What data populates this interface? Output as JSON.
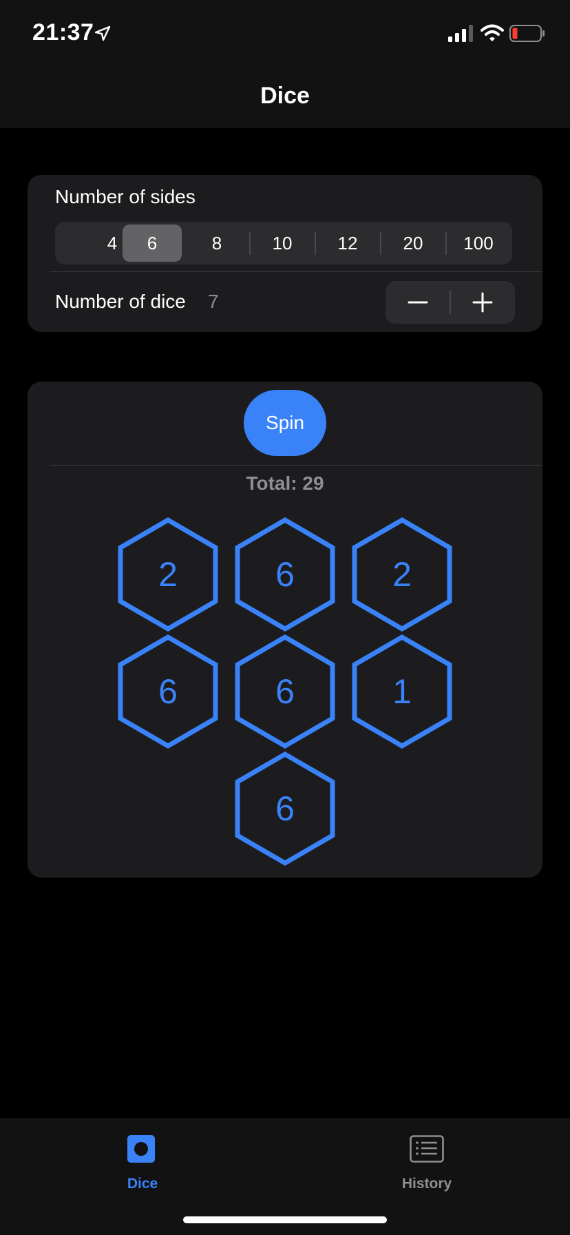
{
  "status_bar": {
    "time": "21:37",
    "icons": [
      "location-arrow-icon",
      "cellular-signal-icon",
      "wifi-icon",
      "battery-low-icon"
    ]
  },
  "nav": {
    "title": "Dice"
  },
  "settings": {
    "sides_label": "Number of sides",
    "sides_options": [
      "4",
      "6",
      "8",
      "10",
      "12",
      "20",
      "100"
    ],
    "selected_sides": "6",
    "dice_label": "Number of dice",
    "dice_count": "7",
    "stepper": {
      "minus": "−",
      "plus": "+"
    }
  },
  "results": {
    "spin_label": "Spin",
    "total_label": "Total: 29",
    "dice_values": [
      "2",
      "6",
      "2",
      "6",
      "6",
      "1",
      "6"
    ]
  },
  "tabs": [
    {
      "label": "Dice",
      "icon": "die-icon",
      "active": true
    },
    {
      "label": "History",
      "icon": "history-list-icon",
      "active": false
    }
  ],
  "colors": {
    "accent": "#3a82f7",
    "background": "#000000",
    "card": "#1c1c1e",
    "secondary_text": "#8e8e93"
  }
}
